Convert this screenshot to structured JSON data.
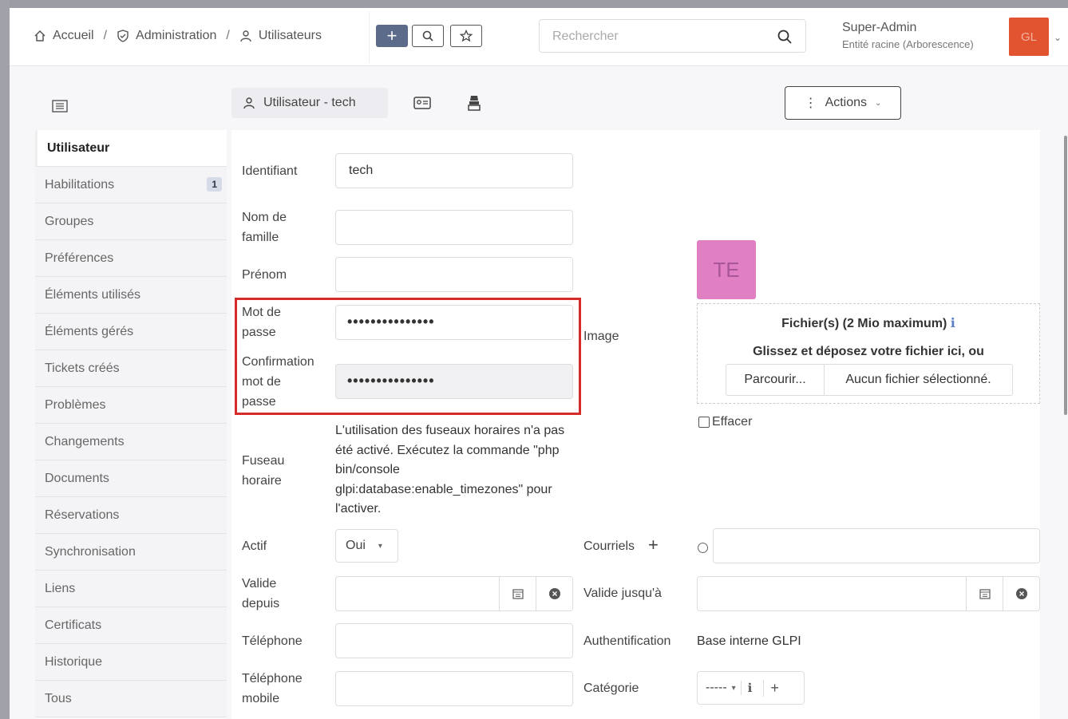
{
  "header": {
    "breadcrumb": {
      "home": "Accueil",
      "admin": "Administration",
      "users": "Utilisateurs",
      "separator": "/"
    },
    "add_label": "+",
    "search_placeholder": "Rechercher",
    "user": {
      "name": "Super-Admin",
      "entity": "Entité racine (Arborescence)",
      "initials": "GL"
    }
  },
  "toolbar": {
    "record_title": "Utilisateur - tech",
    "actions_label": "Actions"
  },
  "sidebar": {
    "items": [
      {
        "label": "Utilisateur",
        "active": true
      },
      {
        "label": "Habilitations",
        "badge": "1"
      },
      {
        "label": "Groupes"
      },
      {
        "label": "Préférences"
      },
      {
        "label": "Éléments utilisés"
      },
      {
        "label": "Éléments gérés"
      },
      {
        "label": "Tickets créés"
      },
      {
        "label": "Problèmes"
      },
      {
        "label": "Changements"
      },
      {
        "label": "Documents"
      },
      {
        "label": "Réservations"
      },
      {
        "label": "Synchronisation"
      },
      {
        "label": "Liens"
      },
      {
        "label": "Certificats"
      },
      {
        "label": "Historique"
      },
      {
        "label": "Tous"
      }
    ]
  },
  "form": {
    "login_label": "Identifiant",
    "login_value": "tech",
    "lastname_label_1": "Nom de",
    "lastname_label_2": "famille",
    "firstname_label": "Prénom",
    "password_label_1": "Mot de",
    "password_label_2": "passe",
    "password_value": "•••••••••••••••",
    "confirm_label_1": "Confirmation",
    "confirm_label_2": "mot de",
    "confirm_label_3": "passe",
    "confirm_value": "•••••••••••••••",
    "timezone_label_1": "Fuseau",
    "timezone_label_2": "horaire",
    "timezone_text": "L'utilisation des fuseaux horaires n'a pas été activé. Exécutez la commande \"php bin/console glpi:database:enable_timezones\" pour l'activer.",
    "active_label": "Actif",
    "active_value": "Oui",
    "valid_from_label_1": "Valide",
    "valid_from_label_2": "depuis",
    "phone_label": "Téléphone",
    "mobile_label_1": "Téléphone",
    "mobile_label_2": "mobile",
    "image_label": "Image",
    "avatar_initials": "TE",
    "upload_title": "Fichier(s) (2 Mio maximum)",
    "upload_hint": "Glissez et déposez votre fichier ici, ou",
    "browse_label": "Parcourir...",
    "no_file_label": "Aucun fichier sélectionné.",
    "clear_label": "Effacer",
    "emails_label": "Courriels",
    "valid_until_label": "Valide jusqu'à",
    "auth_label": "Authentification",
    "auth_value": "Base interne GLPI",
    "category_label": "Catégorie",
    "category_value": "-----"
  },
  "colors": {
    "accent": "#5c6b8a",
    "avatar": "#e2542f",
    "avatar_te": "#e07fc1",
    "highlight": "#d62b2b"
  }
}
